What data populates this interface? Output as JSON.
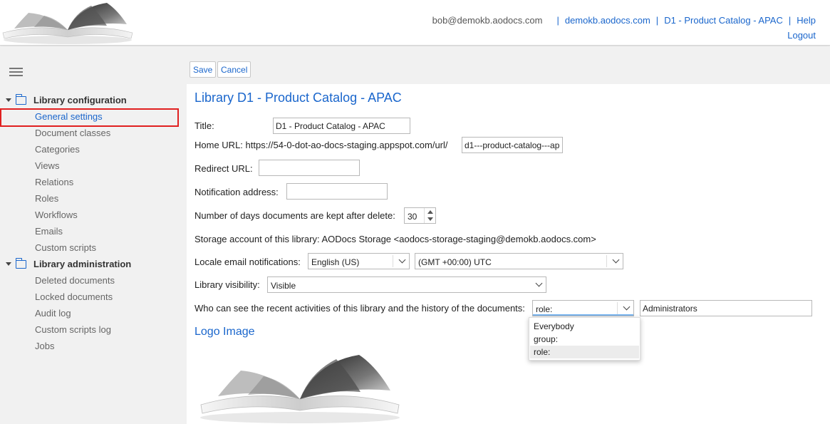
{
  "header": {
    "user_email": "bob@demokb.aodocs.com",
    "links": [
      "demokb.aodocs.com",
      "D1 - Product Catalog - APAC",
      "Help"
    ],
    "separator": "|",
    "logout": "Logout"
  },
  "sidebar": {
    "sections": [
      {
        "label": "Library configuration",
        "items": [
          "General settings",
          "Document classes",
          "Categories",
          "Views",
          "Relations",
          "Roles",
          "Workflows",
          "Emails",
          "Custom scripts"
        ]
      },
      {
        "label": "Library administration",
        "items": [
          "Deleted documents",
          "Locked documents",
          "Audit log",
          "Custom scripts log",
          "Jobs"
        ]
      }
    ],
    "active_item": "General settings"
  },
  "toolbar": {
    "save_label": "Save",
    "cancel_label": "Cancel"
  },
  "page": {
    "title": "Library D1 - Product Catalog - APAC",
    "title_label": "Title:",
    "title_value": "D1 - Product Catalog - APAC",
    "home_url_label": "Home URL: https://54-0-dot-ao-docs-staging.appspot.com/url/",
    "home_url_value": "d1---product-catalog---ap",
    "redirect_url_label": "Redirect URL:",
    "redirect_url_value": "",
    "notification_label": "Notification address:",
    "notification_value": "",
    "days_label": "Number of days documents are kept after delete:",
    "days_value": "30",
    "storage_text": "Storage account of this library: AODocs Storage <aodocs-storage-staging@demokb.aodocs.com>",
    "locale_label": "Locale email notifications:",
    "locale_language": "English (US)",
    "locale_timezone": "(GMT +00:00) UTC",
    "visibility_label": "Library visibility:",
    "visibility_value": "Visible",
    "activities_label": "Who can see the recent activities of this library and the history of the documents:",
    "activities_select": "role:",
    "activities_value": "Administrators",
    "activities_options": [
      "Everybody",
      "group:",
      "role:"
    ],
    "logo_section_title": "Logo Image"
  },
  "colors": {
    "accent": "#1a66cc",
    "highlight_box": "#e02020"
  },
  "icons": {
    "menu": "hamburger-icon",
    "folder": "folder-icon",
    "caret": "caret-down-icon"
  }
}
